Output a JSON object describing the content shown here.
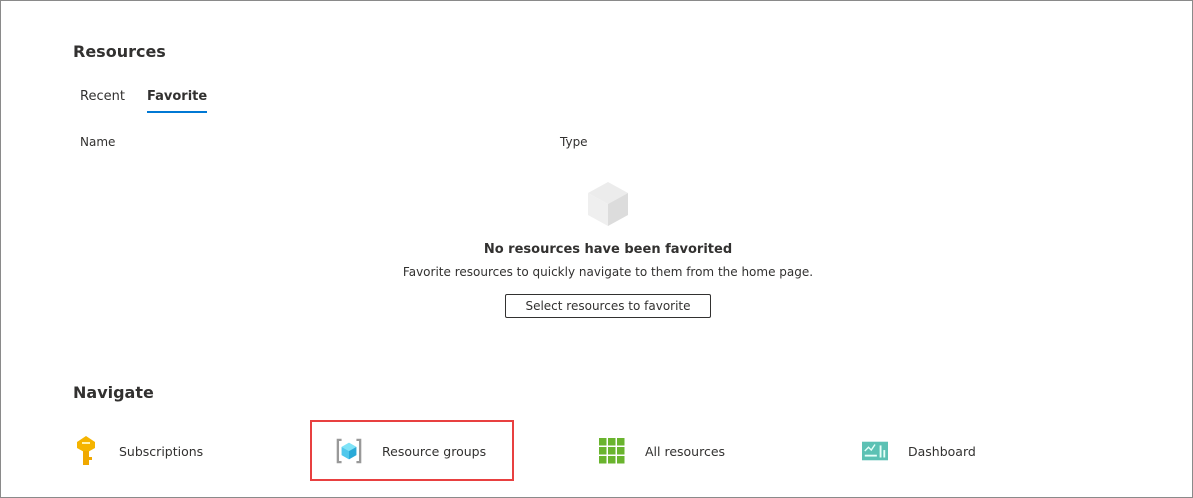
{
  "resources": {
    "title": "Resources",
    "tabs": [
      {
        "label": "Recent"
      },
      {
        "label": "Favorite",
        "selected": true
      }
    ],
    "columns": [
      "Name",
      "Type"
    ],
    "empty": {
      "title": "No resources have been favorited",
      "subtitle": "Favorite resources to quickly navigate to them from the home page.",
      "button": "Select resources to favorite"
    }
  },
  "navigate": {
    "title": "Navigate",
    "items": [
      {
        "label": "Subscriptions",
        "icon": "key-icon"
      },
      {
        "label": "Resource groups",
        "icon": "resource-group-icon",
        "highlighted": true
      },
      {
        "label": "All resources",
        "icon": "grid-icon"
      },
      {
        "label": "Dashboard",
        "icon": "dashboard-icon"
      }
    ]
  },
  "colors": {
    "accent": "#0078d4",
    "highlight": "#e84040"
  }
}
